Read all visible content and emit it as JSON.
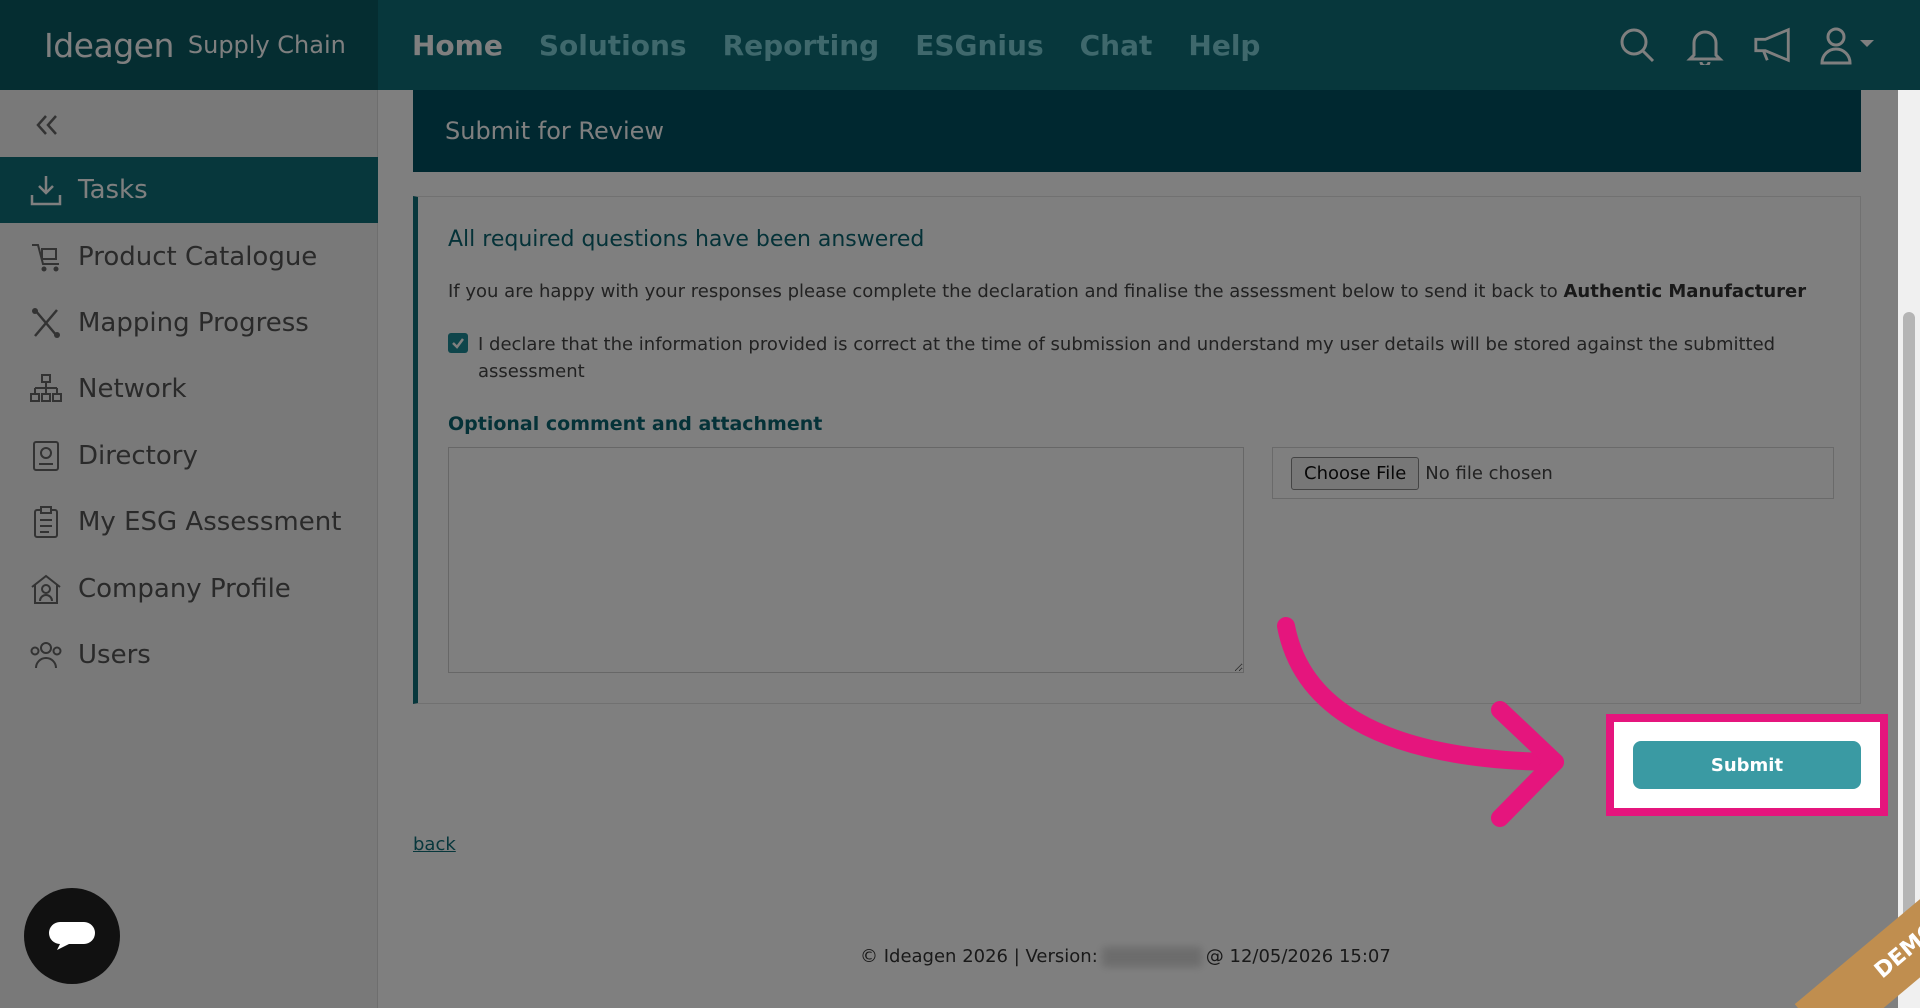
{
  "brand": {
    "name": "Ideagen",
    "product": "Supply Chain"
  },
  "nav": {
    "items": [
      {
        "label": "Home",
        "active": true
      },
      {
        "label": "Solutions",
        "active": false
      },
      {
        "label": "Reporting",
        "active": false
      },
      {
        "label": "ESGnius",
        "active": false
      },
      {
        "label": "Chat",
        "active": false
      },
      {
        "label": "Help",
        "active": false
      }
    ],
    "icons": [
      "search-icon",
      "bell-icon",
      "megaphone-icon",
      "user-icon"
    ]
  },
  "sidebar": {
    "items": [
      {
        "label": "Tasks",
        "icon": "download-tray-icon",
        "active": true
      },
      {
        "label": "Product Catalogue",
        "icon": "cart-icon",
        "active": false
      },
      {
        "label": "Mapping Progress",
        "icon": "mapping-icon",
        "active": false
      },
      {
        "label": "Network",
        "icon": "network-icon",
        "active": false
      },
      {
        "label": "Directory",
        "icon": "directory-icon",
        "active": false
      },
      {
        "label": "My ESG Assessment",
        "icon": "clipboard-icon",
        "active": false
      },
      {
        "label": "Company Profile",
        "icon": "company-icon",
        "active": false
      },
      {
        "label": "Users",
        "icon": "users-icon",
        "active": false
      }
    ]
  },
  "panel": {
    "title": "Submit for Review"
  },
  "card": {
    "title": "All required questions have been answered",
    "desc_prefix": "If you are happy with your responses please complete the declaration and finalise the assessment below to send it back to",
    "recipient": "Authentic Manufacturer",
    "declaration": "I declare that the information provided is correct at the time of submission and understand my user details will be stored against the submitted assessment",
    "declaration_checked": true,
    "optional_label": "Optional comment and attachment",
    "comment_value": "",
    "choose_file_label": "Choose File",
    "no_file_text": "No file chosen"
  },
  "submit_label": "Submit",
  "back_label": "back",
  "footer": {
    "copyright": "© Ideagen 2026 | Version:",
    "datetime": "@ 12/05/2026 15:07"
  },
  "watermark": "DEMO",
  "colors": {
    "primary": "#0e6e78",
    "header": "#005060",
    "highlight": "#e5157d",
    "button": "#3a9aa3"
  }
}
